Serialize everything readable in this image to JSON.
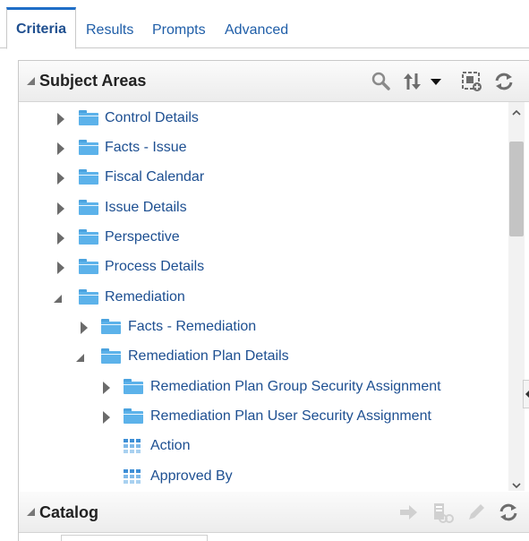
{
  "tabs": [
    {
      "label": "Criteria",
      "active": true
    },
    {
      "label": "Results",
      "active": false
    },
    {
      "label": "Prompts",
      "active": false
    },
    {
      "label": "Advanced",
      "active": false
    }
  ],
  "subject_areas": {
    "title": "Subject Areas",
    "icons": [
      "search-icon",
      "sort-icon",
      "dropdown-icon",
      "add-subject-area-icon",
      "refresh-icon"
    ]
  },
  "tree": {
    "items": [
      {
        "label": "Control Details",
        "type": "folder",
        "level": 0,
        "expanded": false
      },
      {
        "label": "Facts - Issue",
        "type": "folder",
        "level": 0,
        "expanded": false
      },
      {
        "label": "Fiscal Calendar",
        "type": "folder",
        "level": 0,
        "expanded": false
      },
      {
        "label": "Issue Details",
        "type": "folder",
        "level": 0,
        "expanded": false
      },
      {
        "label": "Perspective",
        "type": "folder",
        "level": 0,
        "expanded": false
      },
      {
        "label": "Process Details",
        "type": "folder",
        "level": 0,
        "expanded": false
      },
      {
        "label": "Remediation",
        "type": "folder",
        "level": 0,
        "expanded": true
      },
      {
        "label": "Facts - Remediation",
        "type": "folder",
        "level": 1,
        "expanded": false
      },
      {
        "label": "Remediation Plan Details",
        "type": "folder",
        "level": 1,
        "expanded": true
      },
      {
        "label": "Remediation Plan Group Security Assignment",
        "type": "folder",
        "level": 2,
        "expanded": false
      },
      {
        "label": "Remediation Plan User Security Assignment",
        "type": "folder",
        "level": 2,
        "expanded": false
      },
      {
        "label": "Action",
        "type": "column",
        "level": 2
      },
      {
        "label": "Approved By",
        "type": "column",
        "level": 2
      }
    ]
  },
  "catalog": {
    "title": "Catalog",
    "icons": [
      "arrow-right-icon",
      "catalog-properties-icon",
      "edit-icon",
      "refresh-icon"
    ]
  },
  "colors": {
    "link": "#1d4f91",
    "active_tab_border": "#1f6ec7",
    "folder": "#5cb2ea"
  }
}
